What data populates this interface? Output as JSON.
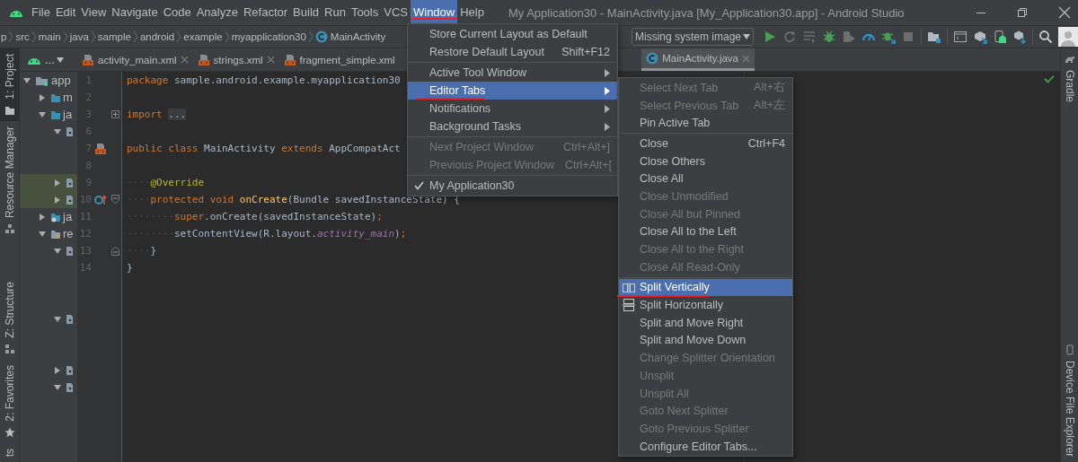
{
  "menu_bar": {
    "items": [
      {
        "label": "File",
        "selected": false
      },
      {
        "label": "Edit",
        "selected": false
      },
      {
        "label": "View",
        "selected": false
      },
      {
        "label": "Navigate",
        "selected": false
      },
      {
        "label": "Code",
        "selected": false
      },
      {
        "label": "Analyze",
        "selected": false
      },
      {
        "label": "Refactor",
        "selected": false
      },
      {
        "label": "Build",
        "selected": false
      },
      {
        "label": "Run",
        "selected": false
      },
      {
        "label": "Tools",
        "selected": false
      },
      {
        "label": "VCS",
        "selected": false
      },
      {
        "label": "Window",
        "selected": true
      },
      {
        "label": "Help",
        "selected": false
      }
    ]
  },
  "window": {
    "title": "My Application30 - MainActivity.java [My_Application30.app] - Android Studio"
  },
  "breadcrumbs": [
    {
      "label": "p",
      "kind": "folder"
    },
    {
      "label": "src",
      "kind": "folder"
    },
    {
      "label": "main",
      "kind": "folder"
    },
    {
      "label": "java",
      "kind": "folder"
    },
    {
      "label": "sample",
      "kind": "folder"
    },
    {
      "label": "android",
      "kind": "folder"
    },
    {
      "label": "example",
      "kind": "folder"
    },
    {
      "label": "myapplication30",
      "kind": "folder"
    },
    {
      "label": "MainActivity",
      "kind": "class"
    }
  ],
  "run_config": {
    "label": "Missing system image"
  },
  "toolbar": [
    {
      "kind": "run",
      "disabled": false
    },
    {
      "kind": "rerun",
      "disabled": true
    },
    {
      "kind": "apply",
      "disabled": true
    },
    {
      "kind": "debug",
      "disabled": false
    },
    {
      "kind": "attach",
      "disabled": true
    },
    {
      "kind": "profile",
      "disabled": false
    },
    {
      "kind": "debug-attach",
      "disabled": false
    },
    {
      "kind": "stop",
      "disabled": true
    },
    {
      "kind": "separator"
    },
    {
      "kind": "project-structure",
      "disabled": false
    },
    {
      "kind": "separator"
    },
    {
      "kind": "terminal",
      "disabled": false
    },
    {
      "kind": "sdk",
      "disabled": false
    },
    {
      "kind": "device",
      "disabled": false
    },
    {
      "kind": "cube",
      "disabled": false
    },
    {
      "kind": "separator"
    },
    {
      "kind": "search",
      "disabled": false
    },
    {
      "kind": "avatar",
      "disabled": false
    }
  ],
  "tool_stripes": {
    "left_top": [
      {
        "label": "1: Project",
        "kind": "project",
        "selected": true
      },
      {
        "label": "Resource Manager",
        "kind": "resources",
        "selected": false
      }
    ],
    "left_bottom": [
      {
        "label": "Z: Structure",
        "kind": "structure",
        "selected": false
      },
      {
        "label": "2: Favorites",
        "kind": "favorites",
        "selected": false
      },
      {
        "label": "ts",
        "kind": "none",
        "selected": false
      }
    ],
    "right_top": [
      {
        "label": "Gradle",
        "kind": "gradle",
        "selected": false
      }
    ],
    "right_bottom": [
      {
        "label": "Device File Explorer",
        "kind": "device",
        "selected": false
      }
    ]
  },
  "project_panel": {
    "view_label": "...",
    "tree": [
      {
        "label": "app",
        "kind": "module",
        "expanded": true,
        "highlighted": false,
        "children": [
          {
            "label": "m",
            "kind": "folder",
            "expanded": false,
            "highlighted": false
          },
          {
            "label": "ja",
            "kind": "folder",
            "expanded": true,
            "highlighted": false,
            "children": [
              {
                "kind": "package",
                "expanded": true,
                "highlighted": false,
                "children": [
                  {
                    "kind": "offscreen"
                  },
                  {
                    "kind": "offscreen"
                  }
                ]
              },
              {
                "kind": "package",
                "expanded": false,
                "highlighted": true
              },
              {
                "kind": "package",
                "expanded": false,
                "highlighted": true
              }
            ]
          },
          {
            "label": "ja",
            "kind": "generated",
            "expanded": false,
            "highlighted": false
          },
          {
            "label": "re",
            "kind": "res",
            "expanded": true,
            "highlighted": false,
            "children": [
              {
                "kind": "package",
                "expanded": true,
                "highlighted": false,
                "children": [
                  {
                    "kind": "offscreen"
                  },
                  {
                    "kind": "offscreen"
                  },
                  {
                    "kind": "offscreen"
                  }
                ]
              },
              {
                "kind": "package",
                "expanded": true,
                "highlighted": false,
                "children": [
                  {
                    "kind": "offscreen"
                  },
                  {
                    "kind": "offscreen"
                  }
                ]
              },
              {
                "kind": "package",
                "expanded": false,
                "highlighted": false
              },
              {
                "kind": "package",
                "expanded": true,
                "highlighted": false,
                "children": [
                  {
                    "kind": "offscreen"
                  },
                  {
                    "kind": "offscreen"
                  },
                  {
                    "kind": "offscreen"
                  },
                  {
                    "kind": "offscreen"
                  }
                ]
              }
            ]
          }
        ]
      }
    ]
  },
  "editor_tabs": [
    {
      "label": "activity_main.xml",
      "kind": "layout",
      "selected": false,
      "closable": true
    },
    {
      "label": "strings.xml",
      "kind": "layout",
      "selected": false,
      "closable": true
    },
    {
      "label": "fragment_simple.xml",
      "kind": "layout",
      "selected": false,
      "closable": false
    },
    {
      "label": "MainActivity.java",
      "kind": "class",
      "selected": true,
      "closable": true
    }
  ],
  "code_lines": [
    {
      "number": "1",
      "tokens": [
        {
          "text": "package",
          "kind": "keyword"
        },
        {
          "text": " sample.android.example.myapplication30",
          "kind": "plain"
        }
      ]
    },
    {
      "number": "2"
    },
    {
      "number": "3",
      "fold": {
        "kind": "collapsed"
      },
      "tokens": [
        {
          "text": "import ",
          "kind": "keyword"
        },
        {
          "text": "...",
          "kind": "folded"
        }
      ]
    },
    {
      "number": "6"
    },
    {
      "number": "7",
      "marker": {
        "kind": "layout"
      },
      "tokens": [
        {
          "text": "public class",
          "kind": "keyword"
        },
        {
          "text": " MainActivity ",
          "kind": "plain"
        },
        {
          "text": "extends",
          "kind": "keyword"
        },
        {
          "text": " AppCompatAct",
          "kind": "plain"
        }
      ]
    },
    {
      "number": "8"
    },
    {
      "number": "9",
      "tokens": [
        {
          "text": "····",
          "kind": "whitespace"
        },
        {
          "text": "@Override",
          "kind": "annotation"
        }
      ]
    },
    {
      "number": "10",
      "marker": {
        "kind": "override"
      },
      "fold": {
        "kind": "start"
      },
      "tokens": [
        {
          "text": "····",
          "kind": "whitespace"
        },
        {
          "text": "protected void ",
          "kind": "keyword"
        },
        {
          "text": "onCreate",
          "kind": "method"
        },
        {
          "text": "(Bundle savedInstanceState) {",
          "kind": "plain"
        }
      ]
    },
    {
      "number": "11",
      "tokens": [
        {
          "text": "········",
          "kind": "whitespace"
        },
        {
          "text": "super",
          "kind": "keyword"
        },
        {
          "text": ".onCreate(savedInstanceState)",
          "kind": "plain"
        },
        {
          "text": ";",
          "kind": "keyword"
        }
      ]
    },
    {
      "number": "12",
      "tokens": [
        {
          "text": "········",
          "kind": "whitespace"
        },
        {
          "text": "setContentView(R.layout.",
          "kind": "plain"
        },
        {
          "text": "activity_main",
          "kind": "field"
        },
        {
          "text": ")",
          "kind": "plain"
        },
        {
          "text": ";",
          "kind": "keyword"
        }
      ]
    },
    {
      "number": "13",
      "fold": {
        "kind": "end"
      },
      "tokens": [
        {
          "text": "····",
          "kind": "whitespace"
        },
        {
          "text": "}",
          "kind": "plain"
        }
      ]
    },
    {
      "number": "14",
      "tokens": [
        {
          "text": "}",
          "kind": "plain"
        }
      ]
    }
  ],
  "window_menu": {
    "items": [
      {
        "kind": "plain",
        "label": "Store Current Layout as Default",
        "disabled": false,
        "selected": false,
        "checked": false
      },
      {
        "kind": "plain",
        "label": "Restore Default Layout",
        "shortcut": "Shift+F12",
        "disabled": false,
        "selected": false,
        "checked": false
      },
      {
        "kind": "separator"
      },
      {
        "kind": "submenu",
        "label": "Active Tool Window",
        "disabled": false,
        "selected": false,
        "checked": false
      },
      {
        "kind": "submenu",
        "label": "Editor Tabs",
        "disabled": false,
        "selected": true,
        "checked": false
      },
      {
        "kind": "submenu",
        "label": "Notifications",
        "disabled": false,
        "selected": false,
        "checked": false
      },
      {
        "kind": "submenu",
        "label": "Background Tasks",
        "disabled": false,
        "selected": false,
        "checked": false
      },
      {
        "kind": "separator"
      },
      {
        "kind": "plain",
        "label": "Next Project Window",
        "shortcut": "Ctrl+Alt+]",
        "disabled": true,
        "selected": false,
        "checked": false
      },
      {
        "kind": "plain",
        "label": "Previous Project Window",
        "shortcut": "Ctrl+Alt+[",
        "disabled": true,
        "selected": false,
        "checked": false
      },
      {
        "kind": "separator"
      },
      {
        "kind": "plain",
        "label": "My Application30",
        "disabled": false,
        "selected": false,
        "checked": true
      }
    ]
  },
  "editor_tabs_menu": {
    "items": [
      {
        "kind": "plain",
        "label": "Select Next Tab",
        "shortcut": "Alt+右",
        "disabled": true,
        "selected": false
      },
      {
        "kind": "plain",
        "label": "Select Previous Tab",
        "shortcut": "Alt+左",
        "disabled": true,
        "selected": false
      },
      {
        "kind": "plain",
        "label": "Pin Active Tab",
        "disabled": false,
        "selected": false
      },
      {
        "kind": "separator"
      },
      {
        "kind": "plain",
        "label": "Close",
        "shortcut": "Ctrl+F4",
        "disabled": false,
        "selected": false
      },
      {
        "kind": "plain",
        "label": "Close Others",
        "disabled": false,
        "selected": false
      },
      {
        "kind": "plain",
        "label": "Close All",
        "disabled": false,
        "selected": false
      },
      {
        "kind": "plain",
        "label": "Close Unmodified",
        "disabled": true,
        "selected": false
      },
      {
        "kind": "plain",
        "label": "Close All but Pinned",
        "disabled": true,
        "selected": false
      },
      {
        "kind": "plain",
        "label": "Close All to the Left",
        "disabled": false,
        "selected": false
      },
      {
        "kind": "plain",
        "label": "Close All to the Right",
        "disabled": true,
        "selected": false
      },
      {
        "kind": "plain",
        "label": "Close All Read-Only",
        "disabled": true,
        "selected": false
      },
      {
        "kind": "separator"
      },
      {
        "kind": "split-vertical",
        "label": "Split Vertically",
        "disabled": false,
        "selected": true
      },
      {
        "kind": "split-horizontal",
        "label": "Split Horizontally",
        "disabled": false,
        "selected": false
      },
      {
        "kind": "plain",
        "label": "Split and Move Right",
        "disabled": false,
        "selected": false
      },
      {
        "kind": "plain",
        "label": "Split and Move Down",
        "disabled": false,
        "selected": false
      },
      {
        "kind": "plain",
        "label": "Change Splitter Orientation",
        "disabled": true,
        "selected": false
      },
      {
        "kind": "plain",
        "label": "Unsplit",
        "disabled": true,
        "selected": false
      },
      {
        "kind": "plain",
        "label": "Unsplit All",
        "disabled": true,
        "selected": false
      },
      {
        "kind": "plain",
        "label": "Goto Next Splitter",
        "disabled": true,
        "selected": false
      },
      {
        "kind": "plain",
        "label": "Goto Previous Splitter",
        "disabled": true,
        "selected": false
      },
      {
        "kind": "plain",
        "label": "Configure Editor Tabs...",
        "disabled": false,
        "selected": false
      }
    ]
  }
}
